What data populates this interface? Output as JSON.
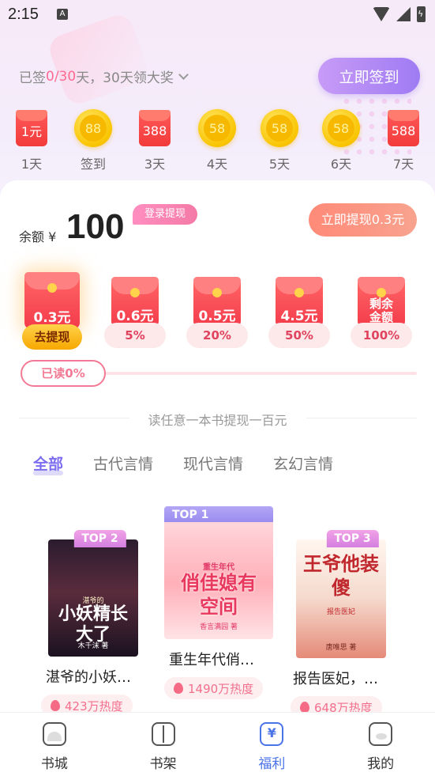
{
  "status_bar": {
    "time": "2:15",
    "notification_glyph": "A"
  },
  "signin": {
    "prefix": "已签 ",
    "count": "0/30",
    "suffix": " 天，30天领大奖",
    "button": "立即签到"
  },
  "days": [
    {
      "type": "redpack",
      "value": "1元",
      "label": "1天"
    },
    {
      "type": "coin",
      "value": "88",
      "label": "签到"
    },
    {
      "type": "redpack",
      "value": "388",
      "label": "3天"
    },
    {
      "type": "coin",
      "value": "58",
      "label": "4天"
    },
    {
      "type": "coin",
      "value": "58",
      "label": "5天"
    },
    {
      "type": "coin",
      "value": "58",
      "label": "6天"
    },
    {
      "type": "redpack",
      "value": "588",
      "label": "7天"
    }
  ],
  "balance": {
    "label": "余额 ¥",
    "value": "100",
    "login_tag": "登录提现",
    "withdraw_button": "立即提现0.3元"
  },
  "tiers": [
    {
      "amount": "0.3元",
      "sub": "去提现",
      "active": true
    },
    {
      "amount": "0.6元",
      "sub": "5%"
    },
    {
      "amount": "0.5元",
      "sub": "20%"
    },
    {
      "amount": "4.5元",
      "sub": "50%"
    },
    {
      "amount": "剩余金额",
      "sub": "100%"
    }
  ],
  "read_progress": {
    "label": "已读0%",
    "fraction": 0
  },
  "divider_text": "读任意一本书提现一百元",
  "tabs": [
    "全部",
    "古代言情",
    "现代言情",
    "玄幻言情"
  ],
  "books": [
    {
      "rank": "TOP 2",
      "title": "湛爷的小妖…",
      "hot": "423万热度",
      "cover_title": "小妖精长大了",
      "cover_small": "湛爷的",
      "cover_author": "木千沫 著"
    },
    {
      "rank": "TOP 1",
      "title": "重生年代俏…",
      "hot": "1490万热度",
      "cover_title": "俏佳媳有空间",
      "cover_small": "重生年代",
      "cover_author": "香言满园 著"
    },
    {
      "rank": "TOP 3",
      "title": "报告医妃，…",
      "hot": "648万热度",
      "cover_title": "王爷他装傻",
      "cover_small": "报告医妃",
      "cover_author": "唐唯思 著"
    }
  ],
  "nav": [
    {
      "label": "书城",
      "icon": "home-icon"
    },
    {
      "label": "书架",
      "icon": "shelf-icon"
    },
    {
      "label": "福利",
      "icon": "welfare-icon",
      "active": true
    },
    {
      "label": "我的",
      "icon": "profile-icon"
    }
  ]
}
